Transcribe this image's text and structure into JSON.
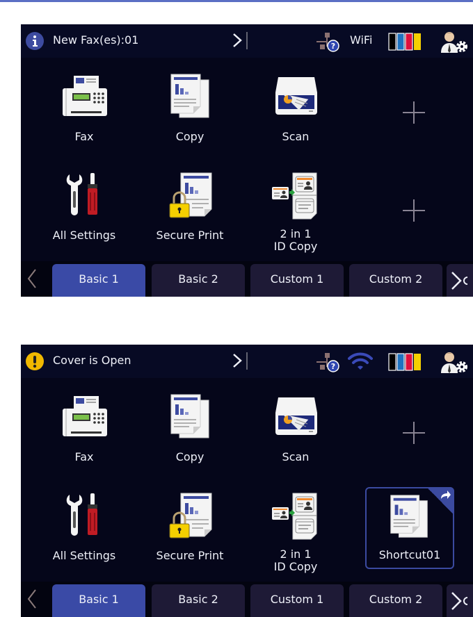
{
  "panels": [
    {
      "status": {
        "icon": "info-icon",
        "message": "New Fax(es):01",
        "wifi_label": "WiFi",
        "network_icon": "wired-network-unknown-icon",
        "ink_icon": "ink-levels-icon",
        "ink_colors": [
          "#000000",
          "#1f73c0",
          "#e0103c",
          "#f5d000"
        ],
        "admin_icon": "admin-settings-icon"
      },
      "tiles": [
        {
          "label": "Fax",
          "icon": "fax-icon"
        },
        {
          "label": "Copy",
          "icon": "copy-icon"
        },
        {
          "label": "Scan",
          "icon": "scan-icon"
        },
        {
          "label": "",
          "icon": "add-shortcut-icon"
        },
        {
          "label": "All Settings",
          "icon": "settings-tools-icon"
        },
        {
          "label": "Secure Print",
          "icon": "secure-print-icon"
        },
        {
          "label_line1": "2 in 1",
          "label_line2": "ID Copy",
          "icon": "id-copy-icon"
        },
        {
          "label": "",
          "icon": "add-shortcut-icon"
        }
      ],
      "tabs": [
        "Basic 1",
        "Basic 2",
        "Custom 1",
        "Custom 2"
      ],
      "active_tab": "Basic 1"
    },
    {
      "status": {
        "icon": "warning-icon",
        "message": "Cover is Open",
        "network_icon": "wired-network-unknown-icon",
        "wifi_icon": "wifi-signal-icon",
        "ink_icon": "ink-levels-icon",
        "admin_icon": "admin-settings-icon"
      },
      "tiles": [
        {
          "label": "Fax",
          "icon": "fax-icon"
        },
        {
          "label": "Copy",
          "icon": "copy-icon"
        },
        {
          "label": "Scan",
          "icon": "scan-icon"
        },
        {
          "label": "",
          "icon": "add-shortcut-icon"
        },
        {
          "label": "All Settings",
          "icon": "settings-tools-icon"
        },
        {
          "label": "Secure Print",
          "icon": "secure-print-icon"
        },
        {
          "label_line1": "2 in 1",
          "label_line2": "ID Copy",
          "icon": "id-copy-icon"
        },
        {
          "label": "Shortcut01",
          "icon": "shortcut-copy-icon"
        }
      ],
      "tabs": [
        "Basic 1",
        "Basic 2",
        "Custom 1",
        "Custom 2"
      ],
      "active_tab": "Basic 1"
    }
  ],
  "colors": {
    "accent": "#3a4aa6",
    "background": "#05061a",
    "status_bar": "#070a24",
    "info": "#3d4ba0",
    "warning": "#f0b800"
  }
}
